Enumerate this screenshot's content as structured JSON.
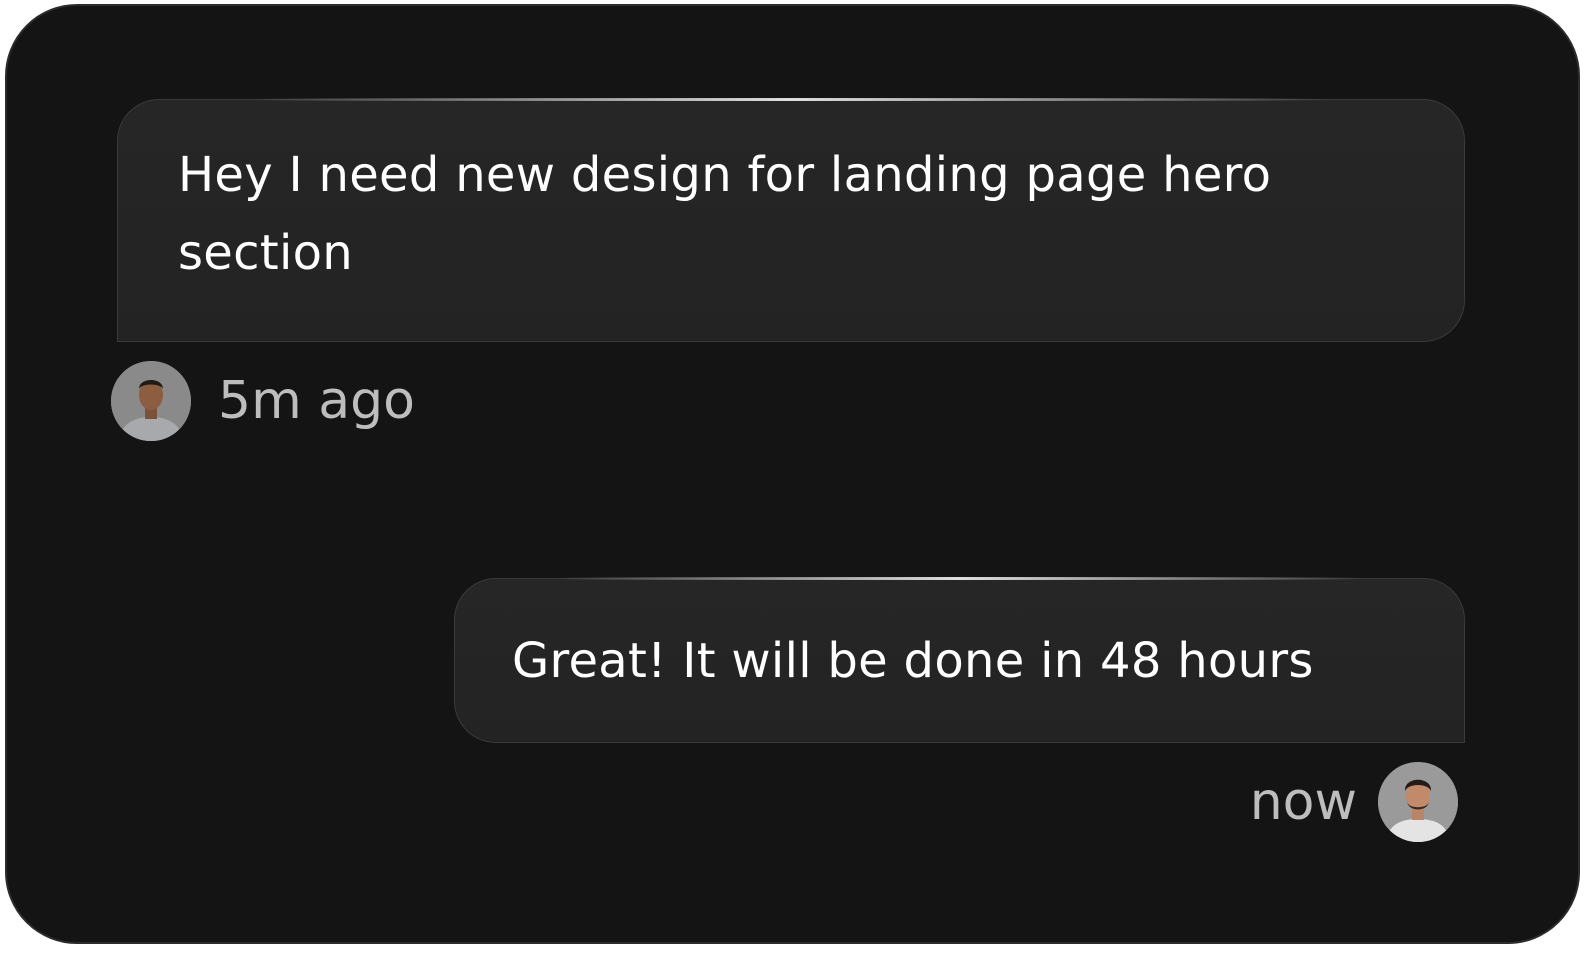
{
  "colors": {
    "card_background": "#141414",
    "bubble_background": "#252525",
    "message_text": "#ffffff",
    "timestamp_text": "#bdbdbd"
  },
  "messages": [
    {
      "direction": "incoming",
      "text": "Hey I need new design for landing page hero section",
      "time": "5m ago",
      "avatar_icon": "person-avatar"
    },
    {
      "direction": "outgoing",
      "text": "Great! It will be done in 48 hours",
      "time": "now",
      "avatar_icon": "person-avatar"
    }
  ]
}
